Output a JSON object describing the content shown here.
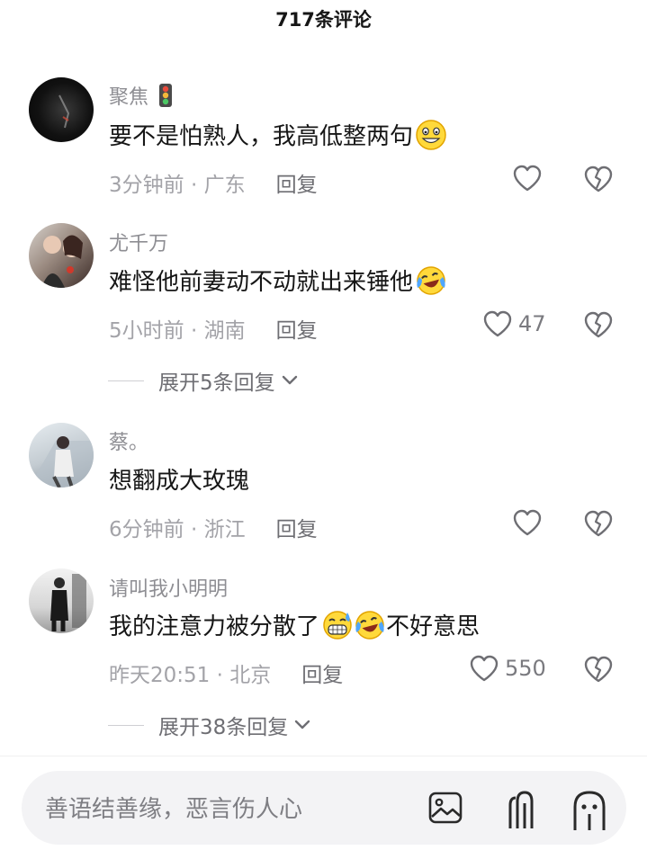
{
  "header": {
    "title": "717条评论"
  },
  "comments": [
    {
      "username": "聚焦",
      "text": "要不是怕熟人，我高低整两句",
      "time_location": "3分钟前 · 广东",
      "reply_label": "回复",
      "likes": "",
      "emojis": [
        "grin-emoji"
      ],
      "has_traffic_light": true
    },
    {
      "username": "尤千万",
      "text": "难怪他前妻动不动就出来锤他",
      "time_location": "5小时前 · 湖南",
      "reply_label": "回复",
      "likes": "47",
      "emojis": [
        "laugh-cry-emoji"
      ],
      "expand": "展开5条回复"
    },
    {
      "username": "蔡。",
      "text": "想翻成大玫瑰",
      "time_location": "6分钟前 · 浙江",
      "reply_label": "回复",
      "likes": ""
    },
    {
      "username": "请叫我小明明",
      "text_before": "我的注意力被分散了",
      "text_after": "不好意思",
      "time_location": "昨天20:51 · 北京",
      "reply_label": "回复",
      "likes": "550",
      "emojis": [
        "sweat-grin-emoji",
        "laugh-cry-emoji"
      ],
      "expand": "展开38条回复"
    }
  ],
  "input": {
    "placeholder": "善语结善缘，恶言伤人心"
  },
  "bottom_icons": [
    "image-icon",
    "at-icon",
    "emoji-icon"
  ],
  "colors": {
    "background": "#ffffff",
    "username": "#8e8e93",
    "meta": "#a3a3a8",
    "input_bg": "#f3f3f5"
  }
}
